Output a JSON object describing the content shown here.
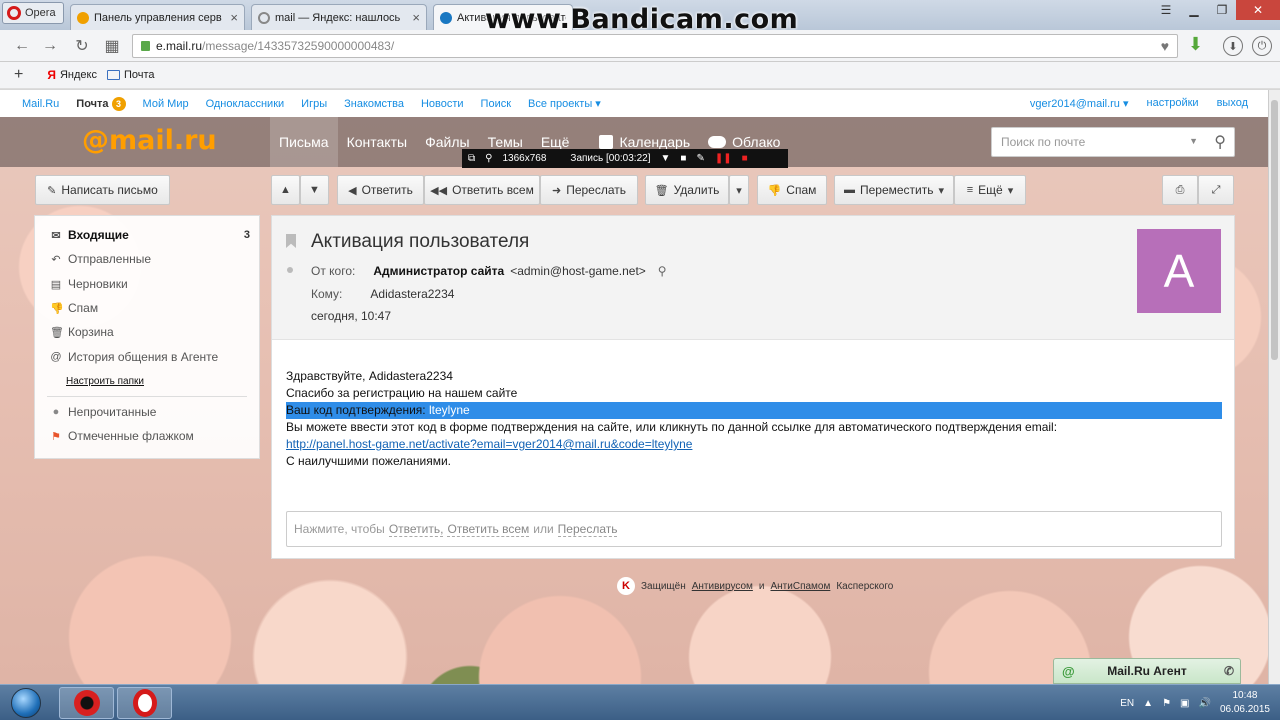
{
  "browser": {
    "menu_label": "Opera",
    "tabs": [
      {
        "title": "Панель управления серв",
        "fav_color": "#f0a000"
      },
      {
        "title": "mail — Яндекс: нашлось",
        "fav_color": "#888888"
      },
      {
        "title": "Активация пользовате",
        "fav_color": "#1a78c2"
      }
    ],
    "watermark": "www.Bandicam.com",
    "url_host": "e.mail.ru",
    "url_path": "/message/14335732590000000483/",
    "bookmarks": [
      {
        "label": "Яндекс"
      },
      {
        "label": "Почта"
      }
    ]
  },
  "portal": {
    "links": [
      "Mail.Ru",
      "Почта",
      "Мой Мир",
      "Одноклассники",
      "Игры",
      "Знакомства",
      "Новости",
      "Поиск",
      "Все проекты ▾"
    ],
    "pochta_badge": "3",
    "user": "vger2014@mail.ru ▾",
    "settings": "настройки",
    "logout": "выход"
  },
  "mail": {
    "logo": "@mail.ru",
    "nav": [
      "Письма",
      "Контакты",
      "Файлы",
      "Темы",
      "Ещё",
      "Календарь",
      "Облако"
    ],
    "search_placeholder": "Поиск по почте"
  },
  "recorder": {
    "resolution": "1366x768",
    "status": "Запись [00:03:22]"
  },
  "toolbar": {
    "compose": "Написать письмо",
    "reply": "Ответить",
    "reply_all": "Ответить всем",
    "forward": "Переслать",
    "delete": "Удалить",
    "spam": "Спам",
    "move": "Переместить",
    "more": "Ещё"
  },
  "folders": [
    {
      "label": "Входящие",
      "count": "3",
      "icon": "envelope-icon"
    },
    {
      "label": "Отправленные",
      "count": "",
      "icon": "sent-icon"
    },
    {
      "label": "Черновики",
      "count": "",
      "icon": "draft-icon"
    },
    {
      "label": "Спам",
      "count": "",
      "icon": "spam-icon"
    },
    {
      "label": "Корзина",
      "count": "",
      "icon": "trash-icon"
    },
    {
      "label": "История общения в Агенте",
      "count": "",
      "icon": "agent-icon"
    }
  ],
  "folder_settings": "Настроить папки",
  "filters": [
    {
      "label": "Непрочитанные"
    },
    {
      "label": "Отмеченные флажком"
    }
  ],
  "message": {
    "subject": "Активация пользователя",
    "from_label": "От кого:",
    "from_name": "Администратор сайта",
    "from_email": "<admin@host-game.net>",
    "to_label": "Кому:",
    "to_value": "Adidastera2234",
    "date": "сегодня, 10:47",
    "avatar_letter": "A",
    "avatar_color": "#b76fb9",
    "body": {
      "greeting": "Здравствуйте, Adidastera2234",
      "thanks": "Спасибо за регистрацию на нашем сайте",
      "code_label": "Ваш код подтверждения:",
      "code": "lteylyne",
      "instructions": "Вы можете ввести этот код в форме подтверждения на сайте, или кликнуть по данной ссылке для автоматического подтверждения email:",
      "link": "http://panel.host-game.net/activate?email=vger2014@mail.ru&code=lteylyne",
      "signoff": "С наилучшими пожеланиями."
    },
    "reply_prompt": "Нажмите, чтобы",
    "reply_link": "Ответить,",
    "reply_all_link": "Ответить всем",
    "reply_or": "или",
    "forward_link": "Переслать"
  },
  "kaspersky": {
    "prefix": "Защищён",
    "antivirus": "Антивирусом",
    "and": "и",
    "antispam": "АнтиСпамом",
    "suffix": "Касперского"
  },
  "agent_label": "Mail.Ru Агент",
  "taskbar": {
    "lang": "EN",
    "time": "10:48",
    "date": "06.06.2015"
  }
}
